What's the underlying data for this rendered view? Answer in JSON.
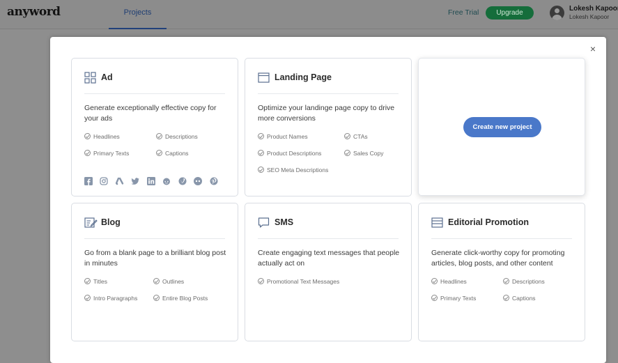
{
  "header": {
    "logo": "anyword",
    "nav_tab": "Projects",
    "free_trial": "Free Trial",
    "upgrade": "Upgrade",
    "user_name": "Lokesh Kapoor",
    "user_sub": "Lokesh Kapoor"
  },
  "modal": {
    "close": "×",
    "create_button": "Create new project",
    "cards": [
      {
        "title": "Ad",
        "icon": "grid-icon",
        "description": "Generate exceptionally effective copy for your ads",
        "features": [
          "Headlines",
          "Descriptions",
          "Primary Texts",
          "Captions"
        ],
        "social_icons": [
          "facebook-icon",
          "instagram-icon",
          "google-ads-icon",
          "twitter-icon",
          "linkedin-icon",
          "reddit-icon",
          "vimeo-icon",
          "tiktok-icon",
          "pinterest-icon"
        ]
      },
      {
        "title": "Landing Page",
        "icon": "browser-window-icon",
        "description": "Optimize your landinge page copy to drive more conversions",
        "features": [
          "Product Names",
          "CTAs",
          "Product Descriptions",
          "Sales Copy",
          "SEO Meta Descriptions"
        ]
      },
      {
        "title": "Blog",
        "icon": "document-edit-icon",
        "description": "Go from a blank page to a brilliant blog post in minutes",
        "features": [
          "Titles",
          "Outlines",
          "Intro Paragraphs",
          "Entire Blog Posts"
        ]
      },
      {
        "title": "SMS",
        "icon": "chat-bubble-icon",
        "description": "Create engaging text messages that people actually act on",
        "features": [
          "Promotional Text Messages"
        ]
      },
      {
        "title": "Editorial Promotion",
        "icon": "layout-icon",
        "description": "Generate click-worthy copy for promoting articles, blog posts, and other content",
        "features": [
          "Headlines",
          "Descriptions",
          "Primary Texts",
          "Captions"
        ]
      }
    ]
  },
  "colors": {
    "accent": "#4a78c9",
    "upgrade": "#156d3b",
    "overlay": "#8e8e8e"
  }
}
